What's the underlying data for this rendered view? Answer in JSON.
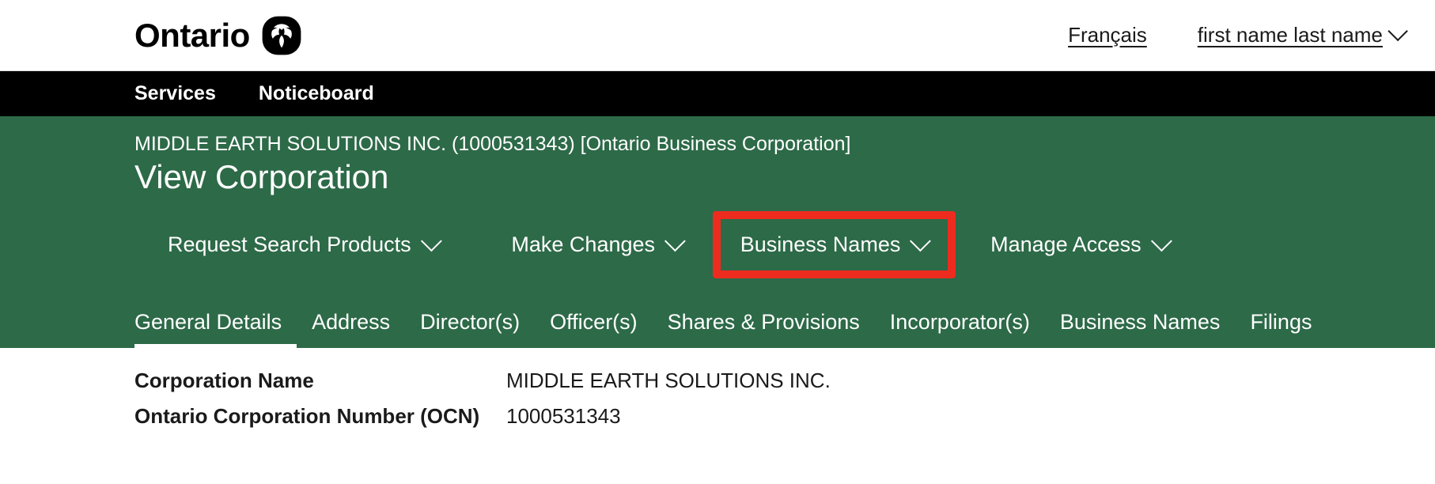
{
  "header": {
    "brand_name": "Ontario",
    "brand_icon": "ontario-trillium-icon",
    "language_link": "Français",
    "user_name": "first name last name",
    "user_chevron_icon": "chevron-down-icon"
  },
  "global_nav": {
    "items": [
      {
        "label": "Services"
      },
      {
        "label": "Noticeboard"
      }
    ]
  },
  "banner": {
    "corporation_line": "MIDDLE EARTH SOLUTIONS INC. (1000531343) [Ontario Business Corporation]",
    "page_title": "View Corporation"
  },
  "actions": {
    "items": [
      {
        "label": "Request Search Products",
        "icon": "chevron-down-icon",
        "highlighted": false
      },
      {
        "label": "Make Changes",
        "icon": "chevron-down-icon",
        "highlighted": false
      },
      {
        "label": "Business Names",
        "icon": "chevron-down-icon",
        "highlighted": true
      },
      {
        "label": "Manage Access",
        "icon": "chevron-down-icon",
        "highlighted": false
      }
    ],
    "highlight_color": "#EE2B1F"
  },
  "tabs": {
    "items": [
      {
        "label": "General Details",
        "active": true
      },
      {
        "label": "Address",
        "active": false
      },
      {
        "label": "Director(s)",
        "active": false
      },
      {
        "label": "Officer(s)",
        "active": false
      },
      {
        "label": "Shares & Provisions",
        "active": false
      },
      {
        "label": "Incorporator(s)",
        "active": false
      },
      {
        "label": "Business Names",
        "active": false
      },
      {
        "label": "Filings",
        "active": false
      }
    ]
  },
  "details": {
    "rows": [
      {
        "label": "Corporation Name",
        "value": "MIDDLE EARTH SOLUTIONS INC."
      },
      {
        "label": "Ontario Corporation Number (OCN)",
        "value": "1000531343"
      }
    ]
  },
  "colors": {
    "banner_green": "#2D6A48",
    "nav_black": "#000000",
    "highlight_red": "#EE2B1F"
  }
}
